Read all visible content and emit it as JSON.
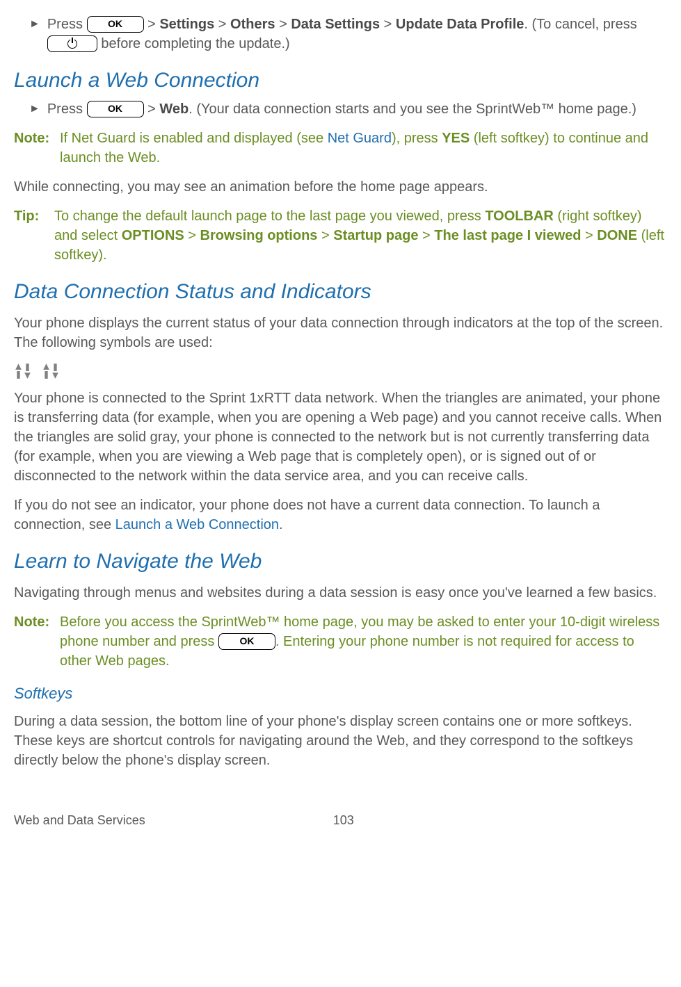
{
  "step1": {
    "press": "Press",
    "ok": "OK",
    "sep": " > ",
    "path": [
      "Settings",
      "Others",
      "Data Settings",
      "Update Data Profile"
    ],
    "trail": ". (To cancel, press ",
    "trail2": " before completing the update.)"
  },
  "h_launch": "Launch a Web Connection",
  "step2": {
    "press": "Press",
    "ok": "OK",
    "sep": " > ",
    "web": "Web",
    "trail": ". (Your data connection starts and you see the SprintWeb™ home page.)"
  },
  "note1": {
    "label": "Note:",
    "t1": "If Net Guard is enabled and displayed (see ",
    "link": "Net Guard",
    "t2": "), press ",
    "yes": "YES",
    "t3": " (left softkey) to continue and launch the Web."
  },
  "p_connecting": "While connecting, you may see an animation before the home page appears.",
  "tip1": {
    "label": "Tip:",
    "t1": "To change the default launch page to the last page you viewed, press ",
    "b1": "TOOLBAR",
    "t2": " (right softkey) and select ",
    "b2": "OPTIONS",
    "sep": " > ",
    "b3": "Browsing options",
    "b4": "Startup page",
    "b5": "The last page I viewed",
    "b6": "DONE",
    "t3": " (left softkey)."
  },
  "h_status": "Data Connection Status and Indicators",
  "p_status": "Your phone displays the current status of your data connection through indicators at the top of the screen. The following symbols are used:",
  "p_1xrtt": "Your phone is connected to the Sprint 1xRTT data network. When the triangles are animated, your phone is transferring data (for example, when you are opening a Web page) and you cannot receive calls. When the triangles are solid gray, your phone is connected to the network but is not currently transferring data (for example, when you are viewing a Web page that is completely open), or is signed out of or disconnected to the network within the data service area, and you can receive calls.",
  "p_noind": {
    "t1": "If you do not see an indicator, your phone does not have a current data connection. To launch a connection, see ",
    "link": "Launch a Web Connection",
    "t2": "."
  },
  "h_learn": "Learn to Navigate the Web",
  "p_learn": "Navigating through menus and websites during a data session is easy once you've learned a few basics.",
  "note2": {
    "label": "Note:",
    "t1": "Before you access the SprintWeb™ home page, you may be asked to enter your 10-digit wireless phone number and press ",
    "ok": "OK",
    "t2": ". Entering your phone number is not required for access to other Web pages."
  },
  "h_softkeys": "Softkeys",
  "p_softkeys": "During a data session, the bottom line of your phone's display screen contains one or more softkeys. These keys are shortcut controls for navigating around the Web, and they correspond to the softkeys directly below the phone's display screen.",
  "footer": {
    "section": "Web and Data Services",
    "page": "103"
  }
}
